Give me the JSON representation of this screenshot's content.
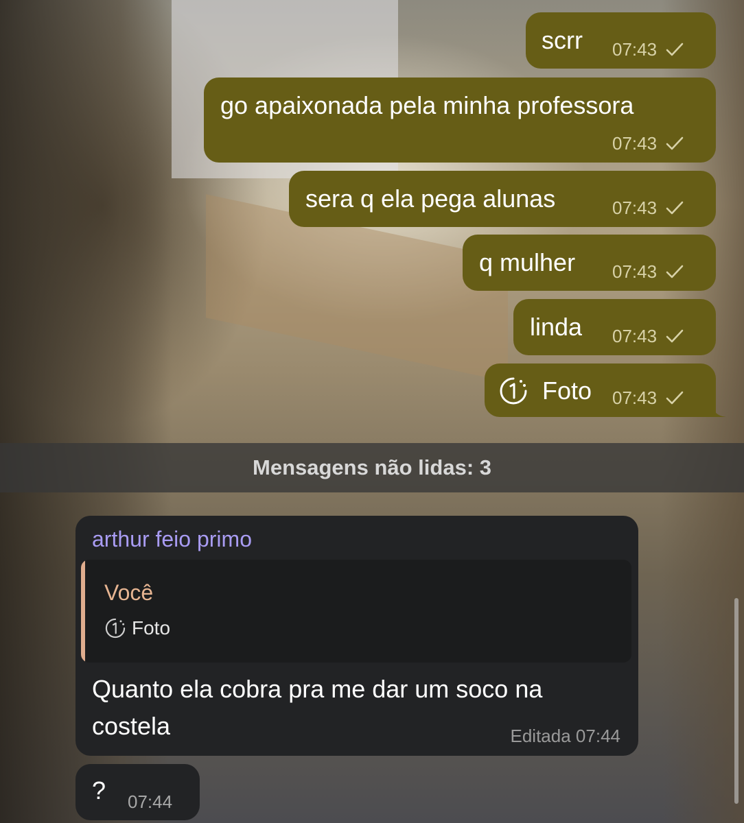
{
  "outgoing_messages": [
    {
      "text": "scrr",
      "time": "07:43"
    },
    {
      "text": "go apaixonada pela minha professora",
      "time": "07:43"
    },
    {
      "text": "sera q ela pega alunas",
      "time": "07:43"
    },
    {
      "text": "q mulher",
      "time": "07:43"
    },
    {
      "text": "linda",
      "time": "07:43"
    },
    {
      "text": "Foto",
      "time": "07:43",
      "icon": "view-once-icon"
    }
  ],
  "unread_banner": "Mensagens não lidas: 3",
  "incoming_reply": {
    "sender": "arthur feio primo",
    "reply_to_name": "Você",
    "reply_to_preview": "Foto",
    "text": "Quanto ela cobra pra me dar um soco na costela",
    "edited_label": "Editada",
    "time": "07:44"
  },
  "incoming_short": {
    "text": "?",
    "time": "07:44"
  },
  "colors": {
    "outgoing_bubble": "#665d16",
    "incoming_bubble": "#222325",
    "sender_name": "#a99cf3",
    "reply_accent": "#e0ad8e"
  }
}
